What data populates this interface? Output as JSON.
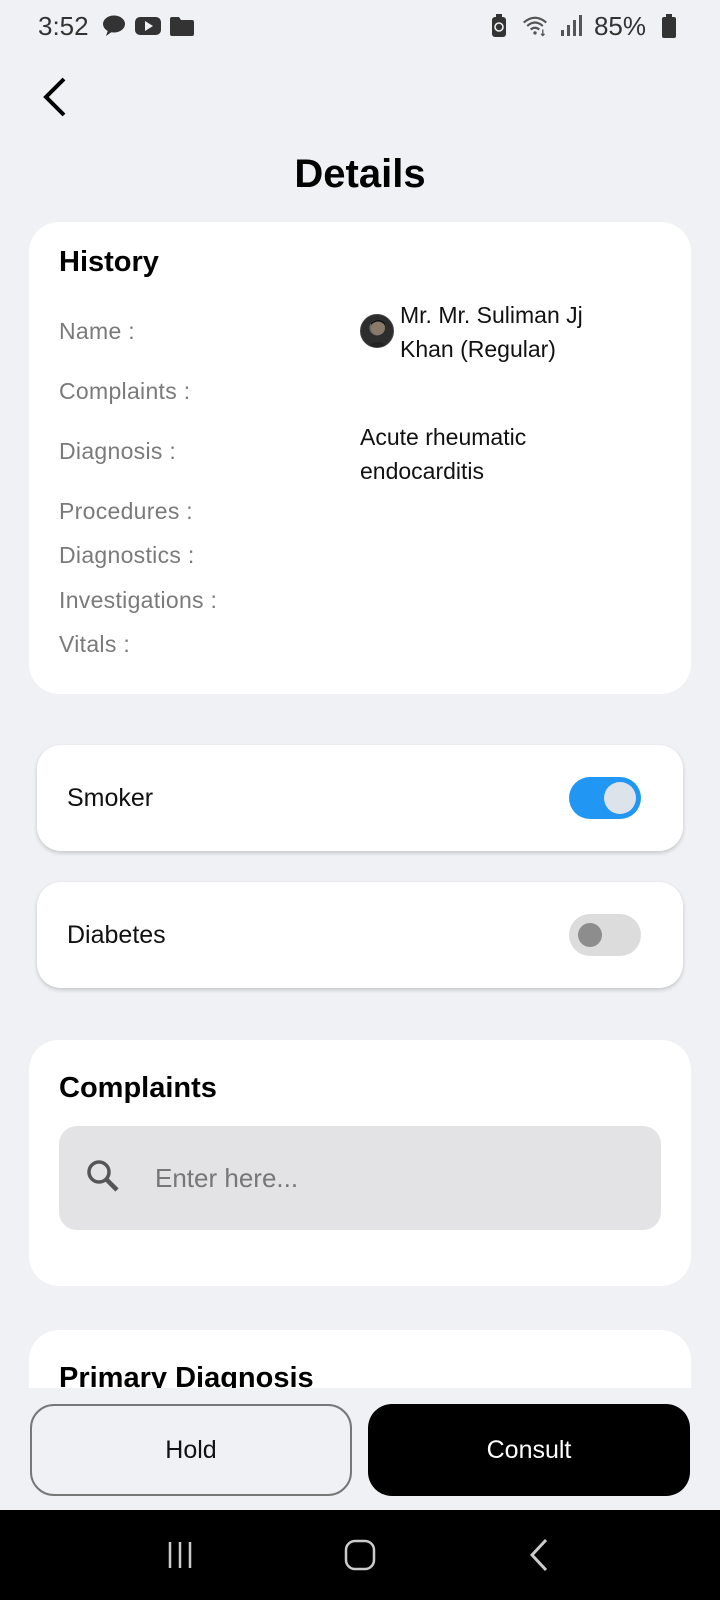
{
  "status_bar": {
    "time": "3:52",
    "battery": "85%"
  },
  "header": {
    "title": "Details"
  },
  "history": {
    "heading": "History",
    "labels": {
      "name": "Name :",
      "complaints": "Complaints :",
      "diagnosis": "Diagnosis :",
      "procedures": "Procedures :",
      "diagnostics": "Diagnostics :",
      "investigations": "Investigations :",
      "vitals": "Vitals :"
    },
    "name_line1": "Mr. Mr. Suliman Jj",
    "name_line2": "Khan  (Regular)",
    "diagnosis_line1": "Acute rheumatic",
    "diagnosis_line2": "endocarditis"
  },
  "toggles": {
    "smoker": {
      "label": "Smoker",
      "state": "on"
    },
    "diabetes": {
      "label": "Diabetes",
      "state": "off"
    }
  },
  "complaints": {
    "heading": "Complaints",
    "placeholder": "Enter here..."
  },
  "primary_diagnosis": {
    "heading": "Primary Diagnosis"
  },
  "actions": {
    "hold": "Hold",
    "consult": "Consult"
  },
  "colors": {
    "accent": "#2196f3",
    "background": "#f0f1f5"
  }
}
